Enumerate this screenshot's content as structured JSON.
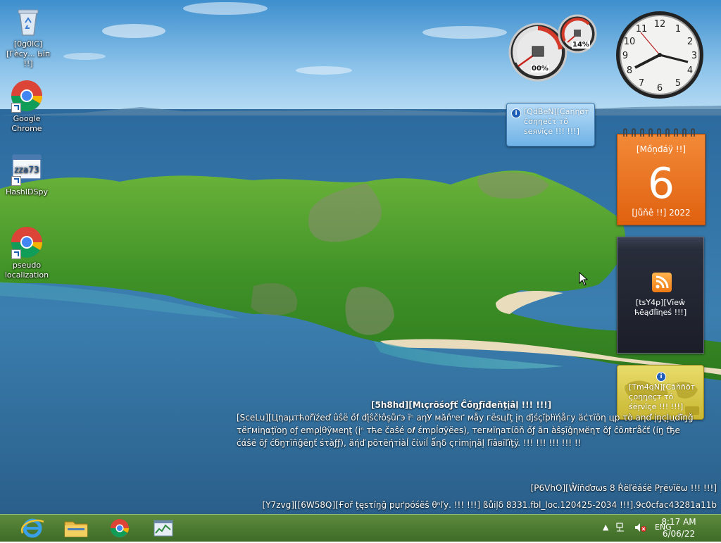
{
  "desktop": {
    "icons": [
      {
        "label": "[0g0lC][Гѐсу... Ьĭп !!]"
      },
      {
        "label": "Google Chrome"
      },
      {
        "label": "HashIDSpy"
      },
      {
        "label": "pseudo localization"
      }
    ]
  },
  "gadgets": {
    "cpu_meter": {
      "cpu_value": "00%",
      "memory_value": "14%"
    },
    "message": {
      "text": "[QdBeN][Çаηηøт ĉσηηеĉτ тô ѕеяνĭçе !!! !!!]"
    },
    "calendar": {
      "day": "[Mőņđáÿ !!]",
      "date": "6",
      "month_year": "[Jůňê !!] 2022"
    },
    "feed": {
      "text": "[tsY4p][Vĭеŵ ћēąđĺïηеś !!!]"
    },
    "weather": {
      "text": "[Tm4qN][Сāňñōт ςοηηеçт τό śёŗνïςе !!! !!!]"
    }
  },
  "watermark": {
    "title": "[5h8hd][Mιçrõśοƒť Ĉőŋƒĩđеňţįâļ !!! !!!]",
    "body": "[SceLu][Цηаμтћоřїźеď ûŝё őf ďįŝčŀôşůґэ ïⁿ аηУ мăňⁿеґ мåу гёѕцľţ įη ďјśçĭþŀïήåгу äċτïōη цр τò аηď įŋςļцďĩŋğ τёґмiηαţїоŋ οƒ еmρļθÿмеηţ (įⁿ тћe čаŝé ο𝒇 έmрĺσÿёеs), тегмïηаτίōň őƒ ãп àŝşīĝηмëητ ŏƒ ĉōлŧґåčť (íŋ ťђе ćάŝё ŏƒ ćбŋтīñĝёŋť śτàƒƒ), äήď рõτëήтіàĺ čίνіĺ ǻηδ ςгіmįηäļ ľĭâвïľïţÿ. !!! !!! !!! !!! !!",
    "build_line1": "[P6VhO][Ŵíňďσωѕ 8 Ŕёľёáśё Ρŗëνĩёω !!! !!!]",
    "build_line2": "[Y7zvg][[6W58Q][Ғοř ţęѕτíŋğ рџґрóśёŝ θⁿľу. !!! !!!] ßůіļδ 8331.fbl_loc.120425-2034 !!!].9c0cfac43281a11b"
  },
  "taskbar": {
    "pinned": [
      "Internet Explorer",
      "File Explorer",
      "Google Chrome",
      "Task Manager"
    ],
    "tray": {
      "language": "ENG",
      "time": "8:17 AM",
      "date": "6/06/22"
    }
  },
  "colors": {
    "taskbar": "#4e7d33",
    "calendar": "#ef7420",
    "message": "#7fbde9",
    "feed": "#252a36",
    "weather": "#dccf4e"
  }
}
